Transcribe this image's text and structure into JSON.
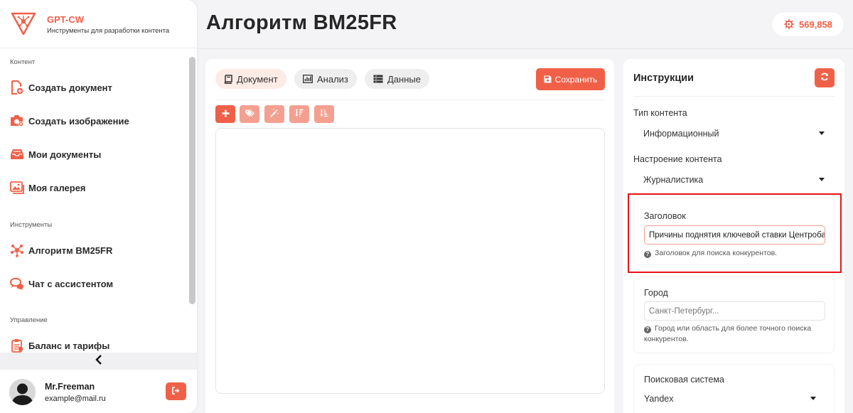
{
  "brand": {
    "name": "GPT-CW",
    "tagline": "Инструменты для разработки контента",
    "color": "#f06048"
  },
  "sidebar": {
    "sections": [
      {
        "label": "Контент"
      },
      {
        "label": "Инструменты"
      },
      {
        "label": "Управление"
      }
    ],
    "items": [
      {
        "label": "Создать документ",
        "icon": "file-plus-icon"
      },
      {
        "label": "Создать изображение",
        "icon": "camera-plus-icon"
      },
      {
        "label": "Мои документы",
        "icon": "inbox-icon"
      },
      {
        "label": "Моя галерея",
        "icon": "images-icon"
      },
      {
        "label": "Алгоритм BM25FR",
        "icon": "network-icon"
      },
      {
        "label": "Чат с ассистентом",
        "icon": "chat-icon"
      },
      {
        "label": "Баланс и тарифы",
        "icon": "clipboard-icon"
      }
    ],
    "collapse_glyph": "‹"
  },
  "user": {
    "name": "Mr.Freeman",
    "email": "example@mail.ru"
  },
  "header": {
    "title": "Алгоритм BM25FR",
    "balance": "569,858"
  },
  "editor": {
    "tabs": [
      {
        "label": "Документ",
        "icon": "book-icon"
      },
      {
        "label": "Анализ",
        "icon": "chart-icon"
      },
      {
        "label": "Данные",
        "icon": "database-icon"
      }
    ],
    "save_label": "Сохранить",
    "tools": [
      "plus-icon",
      "tags-icon",
      "magic-wand-icon",
      "sort-desc-icon",
      "sort-asc-icon"
    ]
  },
  "instructions": {
    "title": "Инструкции",
    "content_type": {
      "label": "Тип контента",
      "value": "Информационный"
    },
    "content_tone": {
      "label": "Настроение контента",
      "value": "Журналистика"
    },
    "headline": {
      "label": "Заголовок",
      "value": "Причины поднятия ключевой ставки Центробанка",
      "help": "Заголовок для поиска конкурентов."
    },
    "city": {
      "label": "Город",
      "placeholder": "Санкт-Петербург...",
      "help": "Город или область для более точного поиска конкурентов."
    },
    "search_engine": {
      "label": "Поисковая система",
      "value": "Yandex"
    }
  }
}
